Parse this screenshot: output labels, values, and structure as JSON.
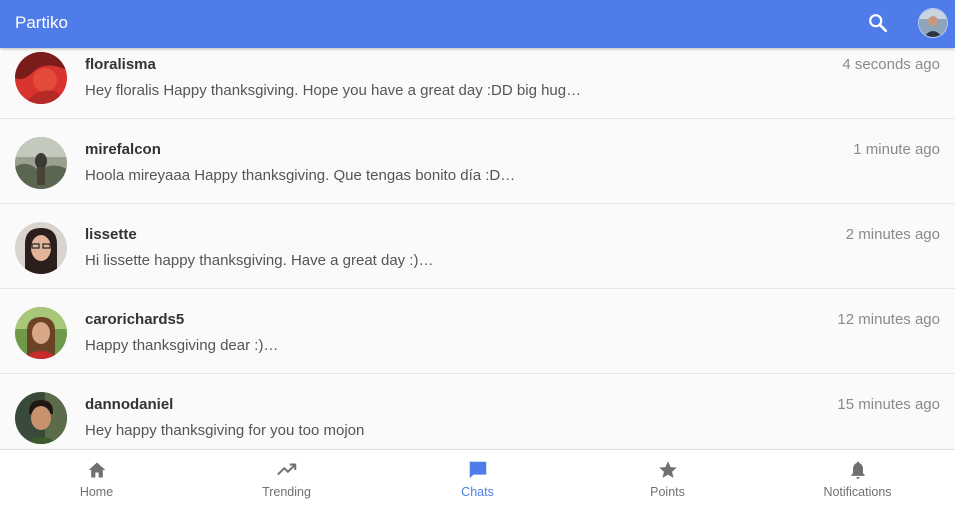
{
  "app": {
    "title": "Partiko"
  },
  "colors": {
    "accent": "#4f7ce8",
    "inactive_icon": "#707070"
  },
  "chats": [
    {
      "name": "floralisma",
      "time": "4 seconds ago",
      "preview": "Hey floralis Happy thanksgiving. Hope you have a great day :DD big hug…"
    },
    {
      "name": "mirefalcon",
      "time": "1 minute ago",
      "preview": "Hoola mireyaaa Happy thanksgiving. Que tengas bonito día :D…"
    },
    {
      "name": "lissette",
      "time": "2 minutes ago",
      "preview": "Hi lissette happy thanksgiving. Have a great day :)…"
    },
    {
      "name": "carorichards5",
      "time": "12 minutes ago",
      "preview": "Happy thanksgiving dear :)…"
    },
    {
      "name": "dannodaniel",
      "time": "15 minutes ago",
      "preview": "Hey happy thanksgiving for you too mojon"
    }
  ],
  "nav": [
    {
      "label": "Home",
      "icon": "home-icon"
    },
    {
      "label": "Trending",
      "icon": "trending-icon"
    },
    {
      "label": "Chats",
      "icon": "chat-icon",
      "active": true
    },
    {
      "label": "Points",
      "icon": "star-icon"
    },
    {
      "label": "Notifications",
      "icon": "bell-icon"
    }
  ]
}
